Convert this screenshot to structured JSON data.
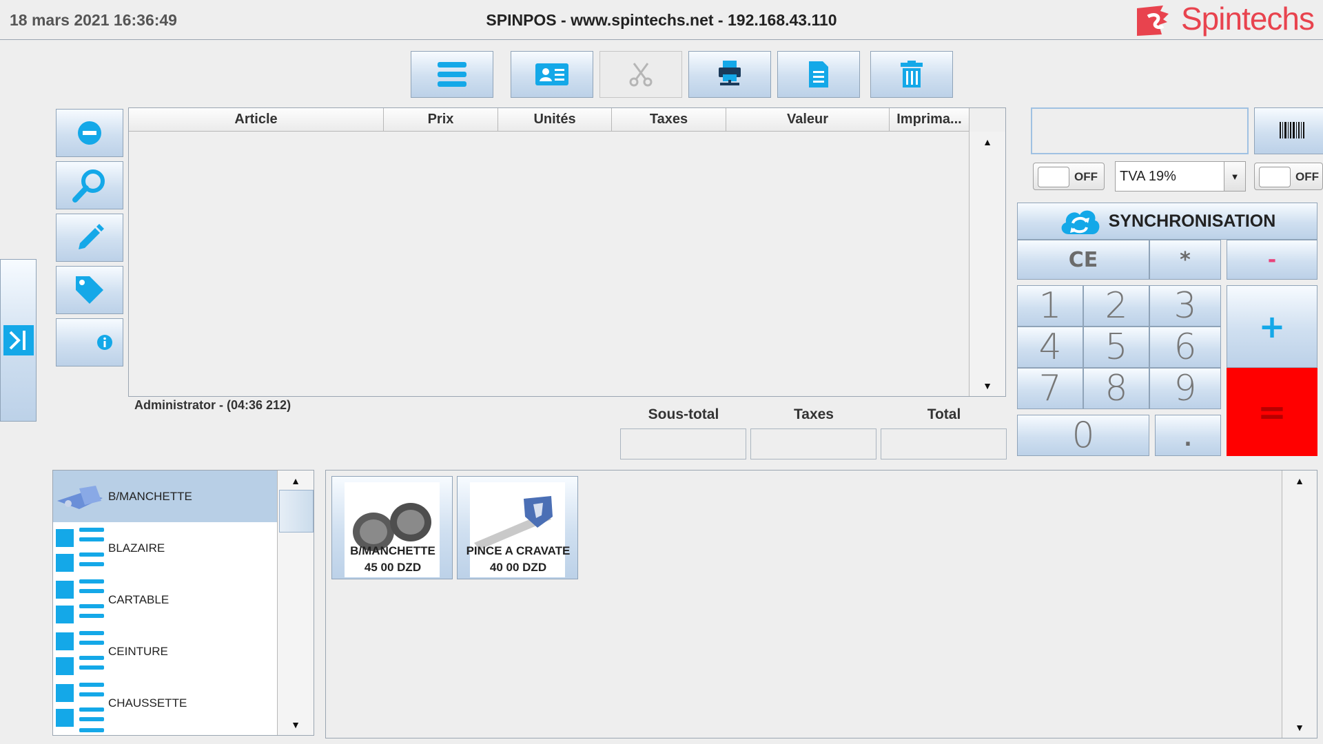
{
  "header": {
    "datetime": "18 mars 2021 16:36:49",
    "title": "SPINPOS - www.spintechs.net - 192.168.43.110",
    "logo_text": "Spintechs"
  },
  "toolbar": {
    "buttons": [
      {
        "icon": "menu-icon",
        "enabled": true
      },
      {
        "icon": "contact-card-icon",
        "enabled": true
      },
      {
        "icon": "scissors-icon",
        "enabled": false
      },
      {
        "icon": "printer-icon",
        "enabled": true
      },
      {
        "icon": "document-icon",
        "enabled": true
      },
      {
        "icon": "trash-icon",
        "enabled": true
      }
    ]
  },
  "side_tools": [
    {
      "icon": "minus-circle-icon"
    },
    {
      "icon": "search-icon"
    },
    {
      "icon": "pencil-icon"
    },
    {
      "icon": "tag-icon"
    },
    {
      "icon": "info-icon"
    }
  ],
  "ticket": {
    "columns": [
      "Article",
      "Prix",
      "Unités",
      "Taxes",
      "Valeur",
      "Imprima..."
    ],
    "rows": []
  },
  "status": {
    "user": "Administrator - (04:36 212)"
  },
  "totals": {
    "subtotal_label": "Sous-total",
    "taxes_label": "Taxes",
    "total_label": "Total",
    "subtotal_value": "",
    "taxes_value": "",
    "total_value": ""
  },
  "right": {
    "toggle1": "OFF",
    "toggle2": "OFF",
    "tax_select": "TVA 19%",
    "sync_label": "SYNCHRONISATION"
  },
  "keypad": {
    "ce": "CE",
    "star": "*",
    "minus": "-",
    "plus": "+",
    "equals": "=",
    "dot": ".",
    "digits": [
      "1",
      "2",
      "3",
      "4",
      "5",
      "6",
      "7",
      "8",
      "9",
      "0"
    ]
  },
  "categories": [
    {
      "label": "B/MANCHETTE",
      "selected": true
    },
    {
      "label": "BLAZAIRE",
      "selected": false
    },
    {
      "label": "CARTABLE",
      "selected": false
    },
    {
      "label": "CEINTURE",
      "selected": false
    },
    {
      "label": "CHAUSSETTE",
      "selected": false
    }
  ],
  "products": [
    {
      "name": "B/MANCHETTE",
      "price": "45 00 DZD"
    },
    {
      "name": "PINCE A CRAVATE",
      "price": "40 00 DZD"
    }
  ],
  "colors": {
    "accent_blue": "#14a8e8",
    "equals_red": "#ff0000",
    "minus_pink": "#e8437a",
    "logo_red": "#e8434e"
  }
}
